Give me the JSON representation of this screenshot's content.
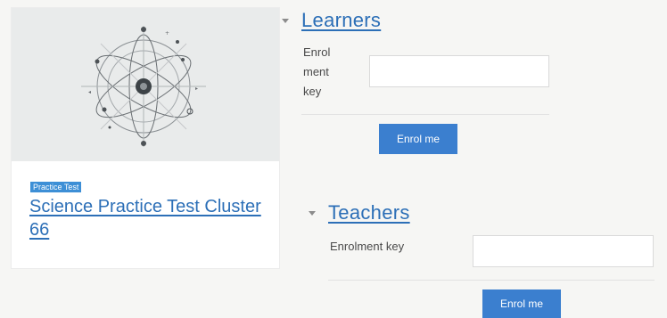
{
  "course": {
    "badge": "Practice Test",
    "title": "Science Practice Test Cluster 66",
    "image_icon": "atom-icon"
  },
  "learners": {
    "title": "Learners",
    "key_label_lines": [
      "Enrol",
      "ment",
      "key"
    ],
    "key_value": "",
    "button": "Enrol me"
  },
  "teachers": {
    "title": "Teachers",
    "key_label": "Enrolment key",
    "key_value": "",
    "button": "Enrol me"
  },
  "colors": {
    "link": "#2c6fb7",
    "button": "#3b7fcf",
    "badge": "#3d8fd6"
  }
}
